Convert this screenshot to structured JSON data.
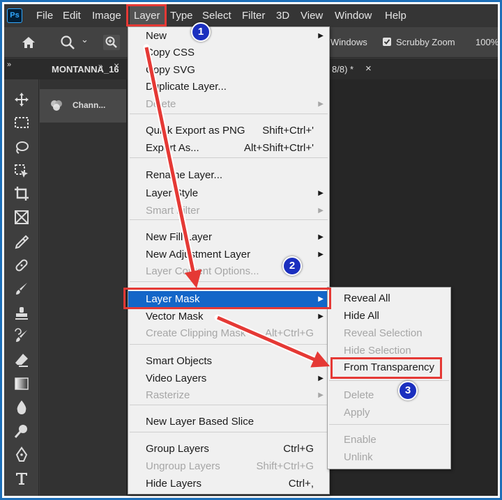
{
  "menubar": {
    "logo": "Ps",
    "items": [
      "File",
      "Edit",
      "Image",
      "Layer",
      "Type",
      "Select",
      "Filter",
      "3D",
      "View",
      "Window",
      "Help"
    ]
  },
  "options_bar": {
    "home_icon": "home-icon",
    "zoom_icon": "zoom-icon",
    "zoom_caret": "⌄",
    "windows_label": "Windows",
    "scrubby_zoom_label": "Scrubby Zoom",
    "zoom_value": "100%"
  },
  "tabs": {
    "doc_left": "MONTANNA_16",
    "doc_right": "8/8) *",
    "close": "×"
  },
  "panel": {
    "collapse": "»",
    "close": "×",
    "channels_label": "Chann..."
  },
  "layer_menu": {
    "items": [
      {
        "label": "New",
        "shortcut": "",
        "submenu": true,
        "disabled": false
      },
      {
        "label": "Copy CSS",
        "shortcut": "",
        "submenu": false,
        "disabled": false
      },
      {
        "label": "Copy SVG",
        "shortcut": "",
        "submenu": false,
        "disabled": false
      },
      {
        "label": "Duplicate Layer...",
        "shortcut": "",
        "submenu": false,
        "disabled": false
      },
      {
        "label": "Delete",
        "shortcut": "",
        "submenu": true,
        "disabled": true
      },
      {
        "label": "Quick Export as PNG",
        "shortcut": "Shift+Ctrl+'",
        "submenu": false,
        "disabled": false
      },
      {
        "label": "Export As...",
        "shortcut": "Alt+Shift+Ctrl+'",
        "submenu": false,
        "disabled": false
      },
      {
        "label": "Rename Layer...",
        "shortcut": "",
        "submenu": false,
        "disabled": false
      },
      {
        "label": "Layer Style",
        "shortcut": "",
        "submenu": true,
        "disabled": false
      },
      {
        "label": "Smart Filter",
        "shortcut": "",
        "submenu": true,
        "disabled": true
      },
      {
        "label": "New Fill Layer",
        "shortcut": "",
        "submenu": true,
        "disabled": false
      },
      {
        "label": "New Adjustment Layer",
        "shortcut": "",
        "submenu": true,
        "disabled": false
      },
      {
        "label": "Layer Content Options...",
        "shortcut": "",
        "submenu": false,
        "disabled": true
      },
      {
        "label": "Layer Mask",
        "shortcut": "",
        "submenu": true,
        "disabled": false,
        "selected": true
      },
      {
        "label": "Vector Mask",
        "shortcut": "",
        "submenu": true,
        "disabled": false
      },
      {
        "label": "Create Clipping Mask",
        "shortcut": "Alt+Ctrl+G",
        "submenu": false,
        "disabled": true
      },
      {
        "label": "Smart Objects",
        "shortcut": "",
        "submenu": true,
        "disabled": false
      },
      {
        "label": "Video Layers",
        "shortcut": "",
        "submenu": true,
        "disabled": false
      },
      {
        "label": "Rasterize",
        "shortcut": "",
        "submenu": true,
        "disabled": true
      },
      {
        "label": "New Layer Based Slice",
        "shortcut": "",
        "submenu": false,
        "disabled": false
      },
      {
        "label": "Group Layers",
        "shortcut": "Ctrl+G",
        "submenu": false,
        "disabled": false
      },
      {
        "label": "Ungroup Layers",
        "shortcut": "Shift+Ctrl+G",
        "submenu": false,
        "disabled": true
      },
      {
        "label": "Hide Layers",
        "shortcut": "Ctrl+,",
        "submenu": false,
        "disabled": false
      }
    ]
  },
  "layer_mask_submenu": {
    "items": [
      {
        "label": "Reveal All",
        "disabled": false
      },
      {
        "label": "Hide All",
        "disabled": false
      },
      {
        "label": "Reveal Selection",
        "disabled": true
      },
      {
        "label": "Hide Selection",
        "disabled": true
      },
      {
        "label": "From Transparency",
        "disabled": false
      },
      {
        "label": "Delete",
        "disabled": true
      },
      {
        "label": "Apply",
        "disabled": true
      },
      {
        "label": "Enable",
        "disabled": true
      },
      {
        "label": "Unlink",
        "disabled": true
      }
    ]
  },
  "annotations": {
    "step1": "1",
    "step2": "2",
    "step3": "3",
    "highlight_color": "#e53935",
    "badge_color": "#1b2fbf"
  },
  "colors": {
    "menu_selected": "#1366c8",
    "frame_border": "#1d6fb8"
  }
}
